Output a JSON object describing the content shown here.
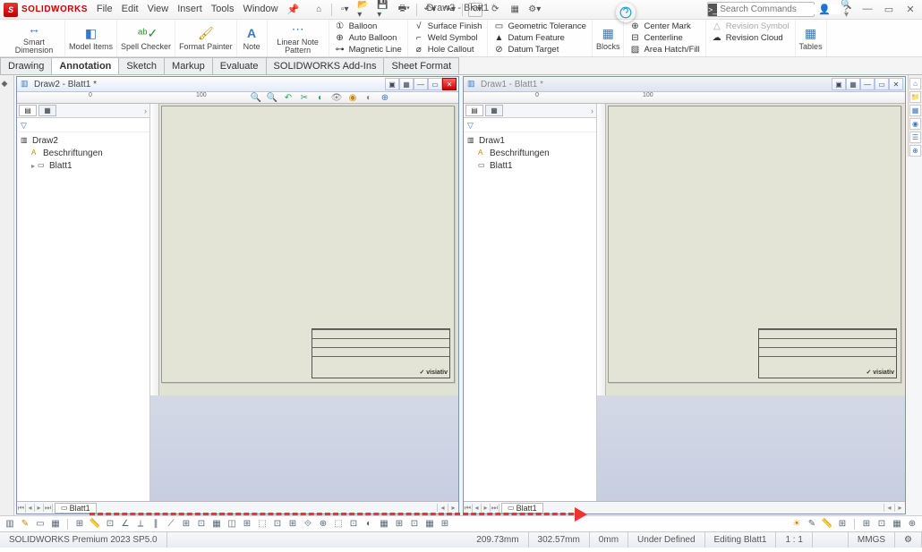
{
  "app": {
    "name": "SOLIDWORKS",
    "doc_title": "Draw2 - Blatt1",
    "doc_mod": "*"
  },
  "menu": [
    "File",
    "Edit",
    "View",
    "Insert",
    "Tools",
    "Window"
  ],
  "qat_icons": [
    "home",
    "new",
    "open",
    "save",
    "print",
    "undo",
    "redo",
    "select",
    "rebuild",
    "opts",
    "gear"
  ],
  "search": {
    "placeholder": "Search Commands"
  },
  "ribbon_big": [
    {
      "label": "Smart Dimension",
      "icon": "↔"
    },
    {
      "label": "Model Items",
      "icon": "◧"
    },
    {
      "label": "Spell Checker",
      "icon": "✓"
    },
    {
      "label": "Format Painter",
      "icon": "🖌"
    },
    {
      "label": "Note",
      "icon": "A"
    },
    {
      "label": "Linear Note Pattern",
      "icon": "⋯"
    }
  ],
  "ribbon_col1": [
    "Balloon",
    "Auto Balloon",
    "Magnetic Line"
  ],
  "ribbon_col2": [
    "Surface Finish",
    "Weld Symbol",
    "Hole Callout"
  ],
  "ribbon_col3": [
    "Geometric Tolerance",
    "Datum Feature",
    "Datum Target"
  ],
  "ribbon_blocks": {
    "label": "Blocks",
    "icon": "▦"
  },
  "ribbon_col4": [
    "Center Mark",
    "Centerline",
    "Area Hatch/Fill"
  ],
  "ribbon_col5": [
    "Revision Symbol",
    "Revision Cloud"
  ],
  "ribbon_tables": {
    "label": "Tables",
    "icon": "▦"
  },
  "cmtabs": [
    "Drawing",
    "Annotation",
    "Sketch",
    "Markup",
    "Evaluate",
    "SOLIDWORKS Add-Ins",
    "Sheet Format"
  ],
  "cmtabs_active": 1,
  "doc_left": {
    "title": "Draw2 - Blatt1 *",
    "ruler_labels": [
      "0",
      "100"
    ],
    "tree_root": "Draw2",
    "tree_children": [
      "Beschriftungen",
      "Blatt1"
    ],
    "sheet_tab": "Blatt1",
    "titleblock_logo": "✓ visiativ"
  },
  "doc_right": {
    "title": "Draw1 - Blatt1 *",
    "ruler_labels": [
      "0",
      "100"
    ],
    "tree_root": "Draw1",
    "tree_children": [
      "Beschriftungen",
      "Blatt1"
    ],
    "sheet_tab": "Blatt1",
    "titleblock_logo": "✓ visiativ"
  },
  "status": {
    "product": "SOLIDWORKS Premium 2023 SP5.0",
    "x": "209.73mm",
    "y": "302.57mm",
    "z": "0mm",
    "state": "Under Defined",
    "mode": "Editing Blatt1",
    "scale": "1 : 1",
    "units": "MMGS"
  }
}
